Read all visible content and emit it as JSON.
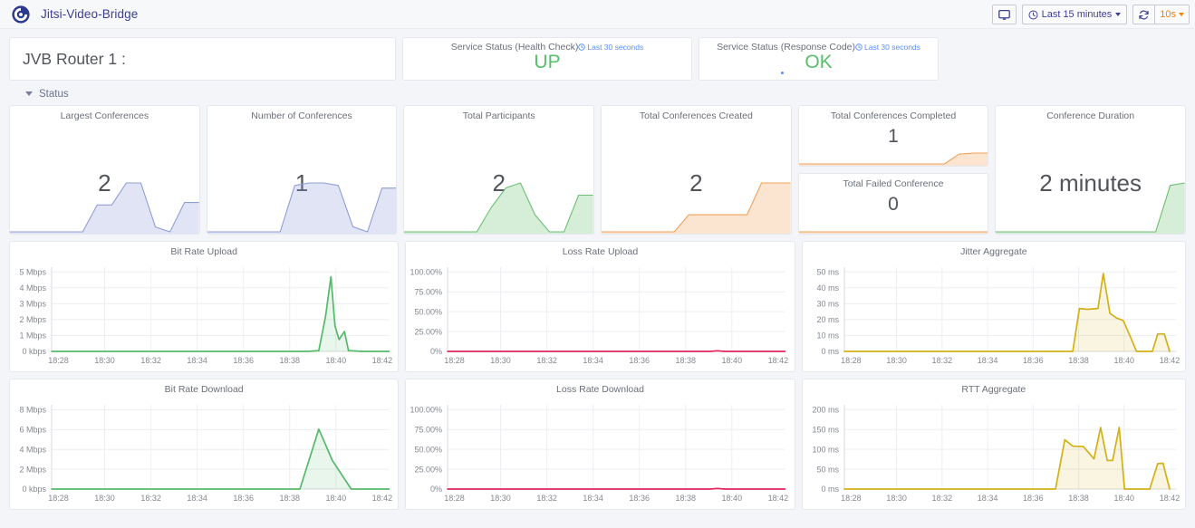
{
  "navbar": {
    "logo_icon": "grafana-logo-icon",
    "title": "Jitsi-Video-Bridge",
    "tv_mode_icon": "monitor-icon",
    "time_picker": {
      "icon": "clock-icon",
      "label": "Last 15 minutes",
      "caret": "chevron-down-icon"
    },
    "refresh": {
      "icon": "refresh-icon",
      "interval": "10s",
      "caret": "chevron-down-icon"
    }
  },
  "header": {
    "router_title": "JVB Router 1 :",
    "health_check": {
      "title": "Service Status (Health Check)",
      "annotation": "Last 30 seconds",
      "annotation_icon": "clock-icon",
      "value": "UP",
      "color": "#56c06a"
    },
    "response_code": {
      "title": "Service Status (Response Code)",
      "annotation": "Last 30 seconds",
      "annotation_icon": "clock-icon",
      "value": "OK",
      "color": "#56c06a"
    }
  },
  "status_row": {
    "label": "Status",
    "icon": "chevron-down-icon",
    "collapsed": false
  },
  "stats": [
    {
      "title": "Largest Conferences",
      "value": "2",
      "color": "#8f9ed6"
    },
    {
      "title": "Number of Conferences",
      "value": "1",
      "color": "#8f9ed6"
    },
    {
      "title": "Total Participants",
      "value": "2",
      "color": "#6cbf73"
    },
    {
      "title": "Total Conferences Created",
      "value": "2",
      "color": "#f0a05a"
    },
    {
      "title": "Total Conferences Completed",
      "value": "1",
      "color": "#f0a05a"
    },
    {
      "title": "Total Failed Conference",
      "value": "0",
      "color": "#f0a05a"
    },
    {
      "title": "Conference Duration",
      "value": "2 minutes",
      "color": "#6cbf73"
    }
  ],
  "chart_data": [
    {
      "type": "line",
      "title": "Bit Rate Upload",
      "xlabel": "",
      "ylabel": "",
      "color": "#56b96a",
      "fill": true,
      "grid": true,
      "ytick_labels": [
        "0 kbps",
        "1 Mbps",
        "2 Mbps",
        "3 Mbps",
        "4 Mbps",
        "5 Mbps"
      ],
      "ytick_values": [
        0,
        1,
        2,
        3,
        4,
        5
      ],
      "ylim": [
        0,
        5.3
      ],
      "xtick_labels": [
        "18:28",
        "18:30",
        "18:32",
        "18:34",
        "18:36",
        "18:38",
        "18:40",
        "18:42"
      ],
      "xlim": [
        18.45,
        18.7
      ],
      "x": [
        18.45,
        18.55,
        18.6,
        18.62,
        18.633,
        18.64,
        18.648,
        18.653,
        18.657,
        18.66,
        18.663,
        18.667,
        18.67,
        18.68,
        18.7
      ],
      "values": [
        0,
        0,
        0,
        0,
        0,
        0,
        0.05,
        2.2,
        4.7,
        1.6,
        0.75,
        1.25,
        0.05,
        0,
        0
      ]
    },
    {
      "type": "line",
      "title": "Loss Rate Upload",
      "xlabel": "",
      "ylabel": "",
      "color": "#e0265a",
      "fill": false,
      "grid": true,
      "ytick_labels": [
        "0%",
        "25.00%",
        "50.00%",
        "75.00%",
        "100.00%"
      ],
      "ytick_values": [
        0,
        25,
        50,
        75,
        100
      ],
      "ylim": [
        0,
        106
      ],
      "xtick_labels": [
        "18:28",
        "18:30",
        "18:32",
        "18:34",
        "18:36",
        "18:38",
        "18:40",
        "18:42"
      ],
      "xlim": [
        18.45,
        18.7
      ],
      "x": [
        18.45,
        18.55,
        18.62,
        18.645,
        18.65,
        18.655,
        18.68,
        18.7
      ],
      "values": [
        0,
        0,
        0,
        0,
        0.8,
        0,
        0,
        0
      ]
    },
    {
      "type": "line",
      "title": "Jitter Aggregate",
      "xlabel": "",
      "ylabel": "",
      "color": "#d4b017",
      "fill": true,
      "grid": true,
      "ytick_labels": [
        "0 ms",
        "10 ms",
        "20 ms",
        "30 ms",
        "40 ms",
        "50 ms"
      ],
      "ytick_values": [
        0,
        10,
        20,
        30,
        40,
        50
      ],
      "ylim": [
        0,
        53
      ],
      "xtick_labels": [
        "18:28",
        "18:30",
        "18:32",
        "18:34",
        "18:36",
        "18:38",
        "18:40",
        "18:42"
      ],
      "xlim": [
        18.45,
        18.7
      ],
      "x": [
        18.45,
        18.55,
        18.61,
        18.622,
        18.627,
        18.633,
        18.641,
        18.645,
        18.65,
        18.655,
        18.66,
        18.665,
        18.67,
        18.676,
        18.682,
        18.686,
        18.691,
        18.695
      ],
      "values": [
        0,
        0,
        0,
        0,
        27,
        26.5,
        27,
        49,
        24,
        21,
        19.5,
        10,
        0,
        0,
        0,
        11,
        11,
        0
      ]
    },
    {
      "type": "line",
      "title": "Bit Rate Download",
      "xlabel": "",
      "ylabel": "",
      "color": "#56b96a",
      "fill": true,
      "grid": true,
      "ytick_labels": [
        "0 kbps",
        "2 Mbps",
        "4 Mbps",
        "6 Mbps",
        "8 Mbps"
      ],
      "ytick_values": [
        0,
        2,
        4,
        6,
        8
      ],
      "ylim": [
        0,
        8.5
      ],
      "xtick_labels": [
        "18:28",
        "18:30",
        "18:32",
        "18:34",
        "18:36",
        "18:38",
        "18:40",
        "18:42"
      ],
      "xlim": [
        18.45,
        18.7
      ],
      "x": [
        18.45,
        18.55,
        18.62,
        18.634,
        18.648,
        18.658,
        18.672,
        18.685,
        18.7
      ],
      "values": [
        0,
        0,
        0,
        0,
        6.05,
        2.9,
        0,
        0,
        0
      ]
    },
    {
      "type": "line",
      "title": "Loss Rate Download",
      "xlabel": "",
      "ylabel": "",
      "color": "#e0265a",
      "fill": false,
      "grid": true,
      "ytick_labels": [
        "0%",
        "25.00%",
        "50.00%",
        "75.00%",
        "100.00%"
      ],
      "ytick_values": [
        0,
        25,
        50,
        75,
        100
      ],
      "ylim": [
        0,
        106
      ],
      "xtick_labels": [
        "18:28",
        "18:30",
        "18:32",
        "18:34",
        "18:36",
        "18:38",
        "18:40",
        "18:42"
      ],
      "xlim": [
        18.45,
        18.7
      ],
      "x": [
        18.45,
        18.55,
        18.62,
        18.645,
        18.65,
        18.655,
        18.68,
        18.7
      ],
      "values": [
        0,
        0,
        0,
        0,
        0.8,
        0,
        0,
        0
      ]
    },
    {
      "type": "line",
      "title": "RTT Aggregate",
      "xlabel": "",
      "ylabel": "",
      "color": "#d4b017",
      "fill": true,
      "grid": true,
      "ytick_labels": [
        "0 ms",
        "50 ms",
        "100 ms",
        "150 ms",
        "200 ms"
      ],
      "ytick_values": [
        0,
        50,
        100,
        150,
        200
      ],
      "ylim": [
        0,
        212
      ],
      "xtick_labels": [
        "18:28",
        "18:30",
        "18:32",
        "18:34",
        "18:36",
        "18:38",
        "18:40",
        "18:42"
      ],
      "xlim": [
        18.45,
        18.7
      ],
      "x": [
        18.45,
        18.55,
        18.609,
        18.616,
        18.622,
        18.63,
        18.638,
        18.643,
        18.648,
        18.652,
        18.657,
        18.661,
        18.665,
        18.669,
        18.673,
        18.68,
        18.686,
        18.69,
        18.695
      ],
      "values": [
        0,
        0,
        0,
        124,
        108,
        107,
        76,
        155,
        72,
        72,
        155,
        0,
        0,
        0,
        0,
        0,
        64,
        65,
        0
      ]
    }
  ],
  "sparklines": {
    "largest_conferences": [
      0,
      0,
      0,
      0,
      0,
      0,
      0.55,
      0.55,
      1,
      1,
      0.1,
      0,
      0.6,
      0.6
    ],
    "number_of_conferences": [
      0,
      0,
      0,
      0,
      0,
      0,
      0.9,
      0.95,
      0.95,
      0.9,
      0.1,
      0,
      0.85,
      0.85
    ],
    "total_participants": [
      0,
      0,
      0,
      0,
      0,
      0,
      0.5,
      0.9,
      1,
      0.35,
      0,
      0,
      0.75,
      0.75
    ],
    "total_conferences_created": [
      0,
      0,
      0,
      0,
      0,
      0,
      0.35,
      0.35,
      0.35,
      0.35,
      0.35,
      1,
      1,
      1
    ],
    "total_conferences_completed": [
      0,
      0,
      0,
      0,
      0,
      0,
      0,
      0,
      0,
      0,
      0,
      0.9,
      1,
      1
    ],
    "total_failed_conference": [
      0,
      0,
      0,
      0,
      0,
      0,
      0,
      0,
      0,
      0,
      0,
      0,
      0,
      0
    ],
    "conference_duration": [
      0,
      0,
      0,
      0,
      0,
      0,
      0,
      0,
      0,
      0,
      0,
      0,
      0.95,
      1
    ]
  }
}
